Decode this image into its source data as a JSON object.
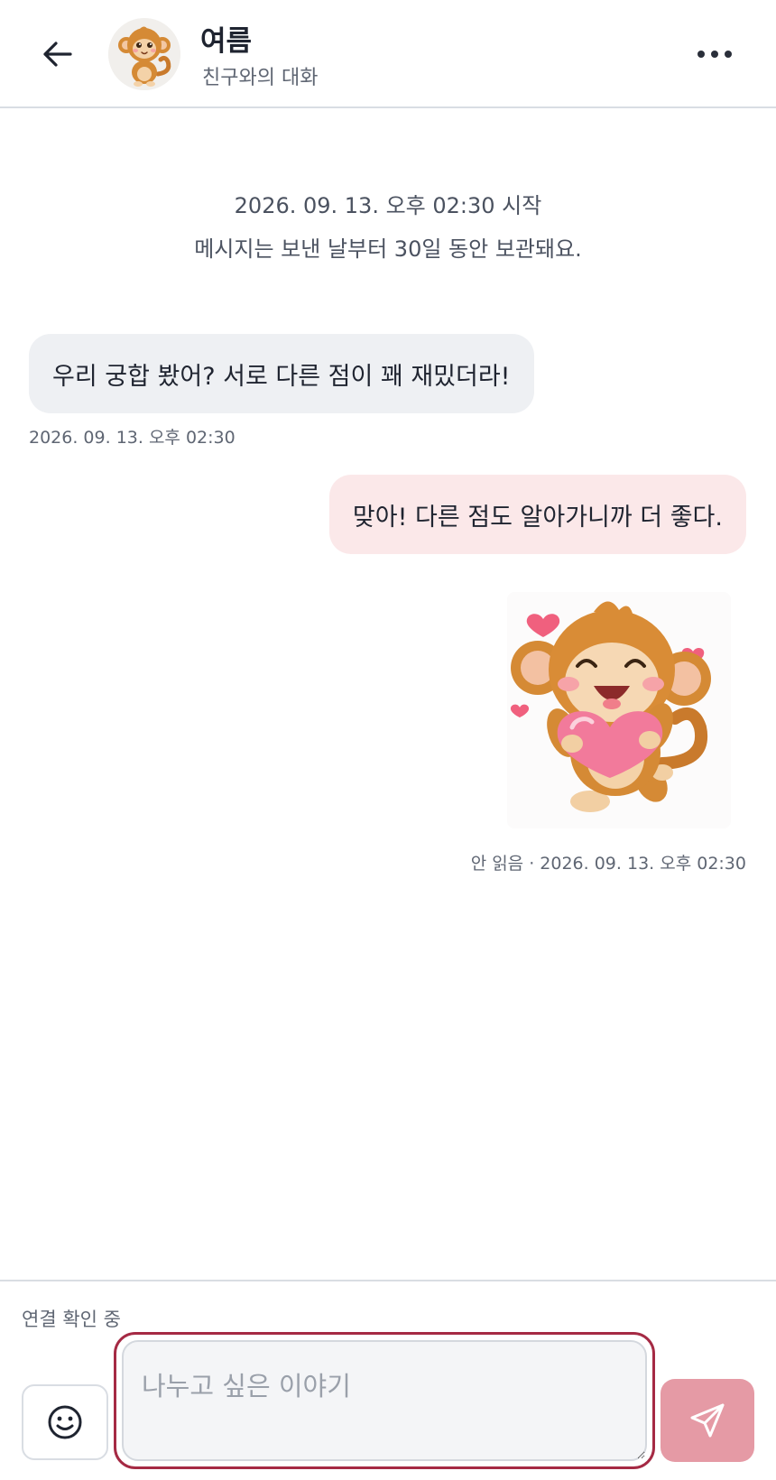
{
  "header": {
    "title": "여름",
    "subtitle": "친구와의 대화",
    "back_icon": "arrow-left-icon",
    "more_icon": "more-horizontal-icon"
  },
  "notice": {
    "started": "2026. 09. 13. 오후 02:30 시작",
    "retention": "메시지는 보낸 날부터 30일 동안 보관돼요."
  },
  "messages": [
    {
      "direction": "incoming",
      "text": "우리 궁합 봤어? 서로 다른 점이 꽤 재밌더라!",
      "time": "2026. 09. 13. 오후 02:30"
    },
    {
      "direction": "outgoing",
      "text": "맞아! 다른 점도 알아가니까 더 좋다."
    },
    {
      "direction": "outgoing",
      "type": "sticker",
      "sticker": "monkey-hugging-heart",
      "meta": "안 읽음 · 2026. 09. 13. 오후 02:30"
    }
  ],
  "composer": {
    "status": "연결 확인 중",
    "placeholder": "나누고 싶은 이야기",
    "value": "",
    "emoji_icon": "smiley-icon",
    "send_icon": "send-icon"
  },
  "colors": {
    "incoming_bubble": "#eef0f3",
    "outgoing_bubble": "#fbe8e9",
    "focus_ring": "#a52a44",
    "send_button": "#e59aa5"
  }
}
